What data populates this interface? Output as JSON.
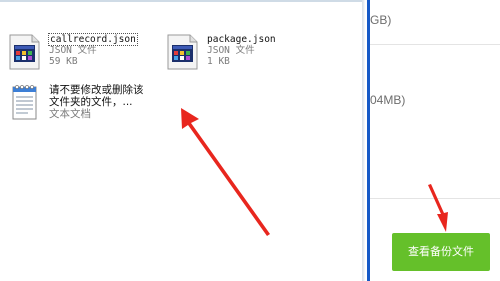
{
  "files": [
    {
      "name": "callrecord.json",
      "type": "JSON 文件",
      "size": "59 KB",
      "selected": true,
      "icon": "json-file-icon"
    },
    {
      "name": "package.json",
      "type": "JSON 文件",
      "size": "1 KB",
      "selected": false,
      "icon": "json-file-icon"
    },
    {
      "name_line1": "请不要修改或删除该",
      "name_line2": "文件夹的文件，...",
      "type": "文本文档",
      "icon": "notepad-file-icon"
    }
  ],
  "right_panel": {
    "text_top": "GB)",
    "text_mid": "04MB)",
    "view_backup_button": "查看备份文件"
  },
  "colors": {
    "divider_blue": "#1559c7",
    "button_green": "#65c02a",
    "arrow_red": "#e8261e"
  }
}
